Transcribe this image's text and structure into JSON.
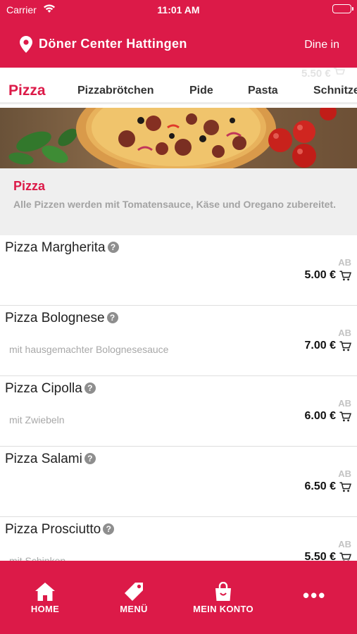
{
  "status_bar": {
    "carrier": "Carrier",
    "time": "11:01 AM"
  },
  "header": {
    "store_name": "Döner Center Hattingen",
    "mode": "Dine in"
  },
  "tabs": {
    "items": [
      "Pizza",
      "Pizzabrötchen",
      "Pide",
      "Pasta",
      "Schnitze"
    ],
    "active": "Pizza",
    "ghost_price": "5.50 €"
  },
  "category": {
    "name": "Pizza",
    "description": "Alle Pizzen werden mit Tomatensauce, Käse und Oregano zubereitet."
  },
  "products": [
    {
      "name": "Pizza Margherita",
      "description": "",
      "prefix": "AB",
      "price": "5.00 €"
    },
    {
      "name": "Pizza Bolognese",
      "description": "mit hausgemachter Bolognesesauce",
      "prefix": "AB",
      "price": "7.00 €"
    },
    {
      "name": "Pizza Cipolla",
      "description": "mit Zwiebeln",
      "prefix": "AB",
      "price": "6.00 €"
    },
    {
      "name": "Pizza Salami",
      "description": "",
      "prefix": "AB",
      "price": "6.50 €"
    },
    {
      "name": "Pizza Prosciutto",
      "description": "mit Schinken",
      "prefix": "AB",
      "price": "5.50 €"
    }
  ],
  "bottom_nav": {
    "home": "HOME",
    "menu": "MENÜ",
    "account": "MEIN KONTO",
    "more": "•••"
  },
  "colors": {
    "brand": "#dc1a48",
    "muted_text": "#a3a3a3",
    "category_bg": "#efefef"
  }
}
